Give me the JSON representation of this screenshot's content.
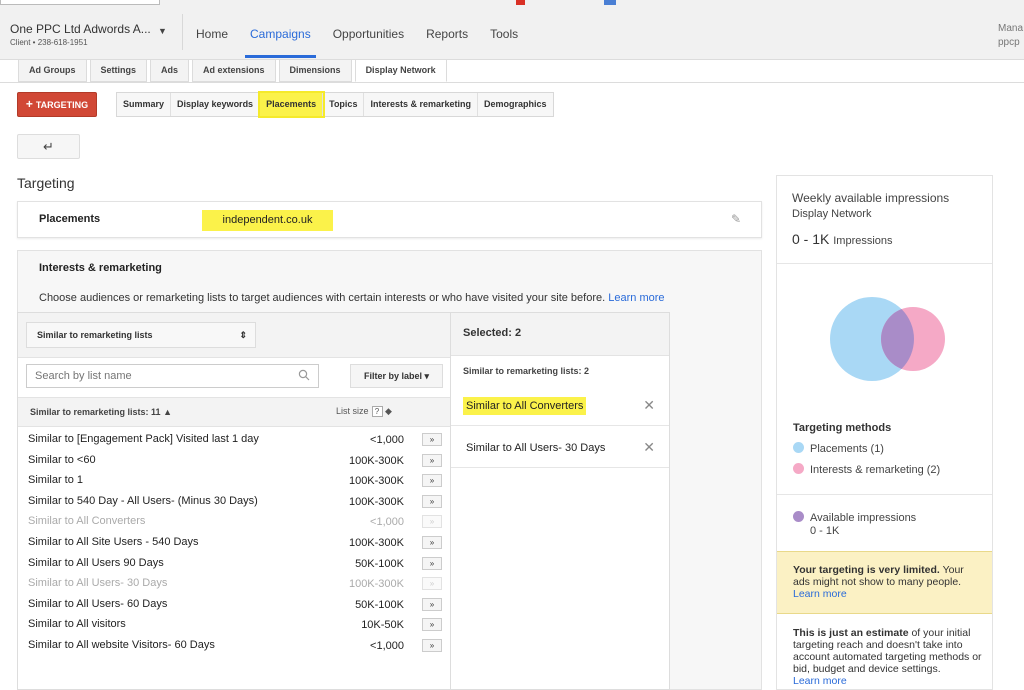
{
  "account": {
    "name": "One PPC Ltd Adwords A...",
    "client_id": "Client • 238-618-1951"
  },
  "nav": {
    "items": [
      {
        "label": "Home",
        "active": false
      },
      {
        "label": "Campaigns",
        "active": true
      },
      {
        "label": "Opportunities",
        "active": false
      },
      {
        "label": "Reports",
        "active": false
      },
      {
        "label": "Tools",
        "active": false
      }
    ],
    "user_line1": "Mana",
    "user_line2": "ppcp"
  },
  "subtabs": [
    "Ad Groups",
    "Settings",
    "Ads",
    "Ad extensions",
    "Dimensions",
    "Display Network"
  ],
  "targeting_button": "TARGETING",
  "segments": [
    "Summary",
    "Display keywords",
    "Placements",
    "Topics",
    "Interests & remarketing",
    "Demographics"
  ],
  "back_icon": "back-arrow-icon",
  "heading": "Targeting",
  "placements": {
    "label": "Placements",
    "value": "independent.co.uk"
  },
  "interests": {
    "title": "Interests & remarketing",
    "description": "Choose audiences or remarketing lists to target audiences with certain interests or who have visited your site before.",
    "learn_more": "Learn more"
  },
  "list": {
    "type_select": "Similar to remarketing lists",
    "search_placeholder": "Search by list name",
    "filter_label": "Filter by label",
    "count_label": "Similar to remarketing lists: 11",
    "size_label": "List size",
    "help": "?",
    "rows": [
      {
        "name": "Similar to [Engagement Pack] Visited last 1 day",
        "size": "<1,000",
        "disabled": false
      },
      {
        "name": "Similar to <60",
        "size": "100K-300K",
        "disabled": false
      },
      {
        "name": "Similar to 1",
        "size": "100K-300K",
        "disabled": false
      },
      {
        "name": "Similar to 540 Day - All Users- (Minus 30 Days)",
        "size": "100K-300K",
        "disabled": false
      },
      {
        "name": "Similar to All Converters",
        "size": "<1,000",
        "disabled": true
      },
      {
        "name": "Similar to All Site Users - 540 Days",
        "size": "100K-300K",
        "disabled": false
      },
      {
        "name": "Similar to All Users 90 Days",
        "size": "50K-100K",
        "disabled": false
      },
      {
        "name": "Similar to All Users- 30 Days",
        "size": "100K-300K",
        "disabled": true
      },
      {
        "name": "Similar to All Users- 60 Days",
        "size": "50K-100K",
        "disabled": false
      },
      {
        "name": "Similar to All visitors",
        "size": "10K-50K",
        "disabled": false
      },
      {
        "name": "Similar to All website Visitors- 60 Days",
        "size": "<1,000",
        "disabled": false
      }
    ]
  },
  "selected": {
    "header": "Selected: 2",
    "subheader": "Similar to remarketing lists: 2",
    "items": [
      "Similar to All Converters",
      "Similar to All Users- 30 Days"
    ]
  },
  "sidebar": {
    "weekly_label": "Weekly available impressions",
    "network": "Display Network",
    "impressions_value": "0 - 1K",
    "impressions_unit": "Impressions",
    "targeting_methods_label": "Targeting methods",
    "legend_placements": "Placements (1)",
    "legend_interests": "Interests & remarketing (2)",
    "available_label": "Available impressions",
    "available_value": "0 - 1K",
    "warn_bold": "Your targeting is very limited.",
    "warn_text": " Your ads might not show to many people.",
    "warn_link": "Learn more",
    "estimate_bold": "This is just an estimate",
    "estimate_text": " of your initial targeting reach and doesn't take into account automated targeting methods or bid, budget and device settings.",
    "estimate_link": "Learn more"
  },
  "colors": {
    "accent": "#2a6bd9",
    "targeting_button": "#d14836",
    "highlight": "#fbf24a",
    "venn_placements": "#a9d8f5",
    "venn_interests": "#f5a9c6",
    "venn_overlap": "#a98cc8",
    "warning_bg": "#fbf1c4"
  }
}
